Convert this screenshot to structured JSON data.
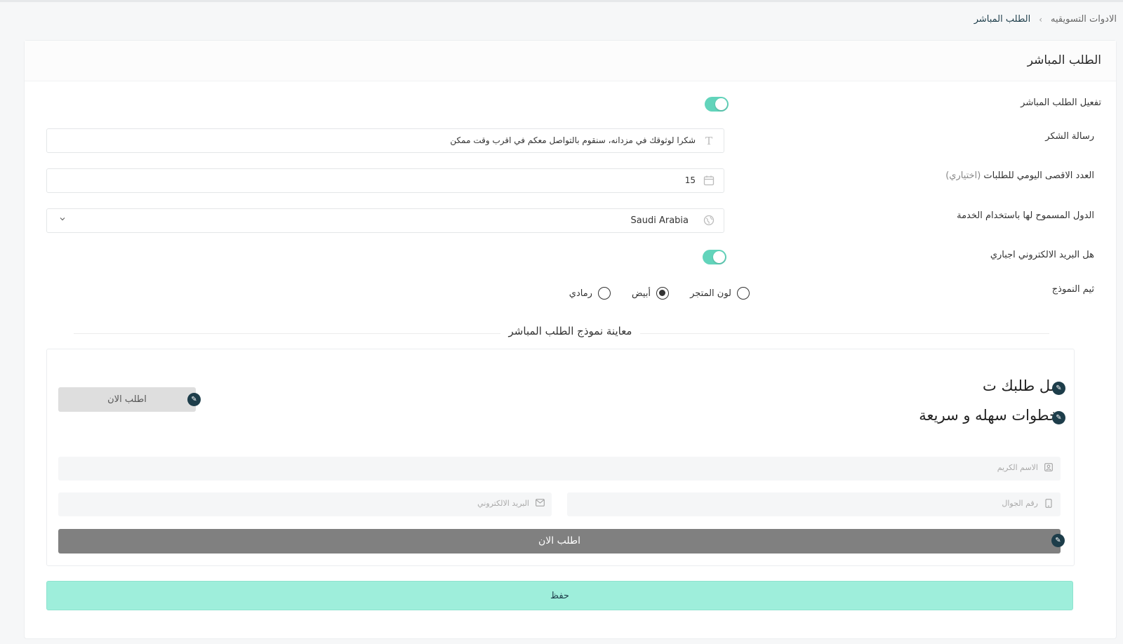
{
  "breadcrumb": {
    "parent": "الادوات التسويقيه",
    "separator": "›",
    "current": "الطلب المباشر"
  },
  "card": {
    "title": "الطلب المباشر"
  },
  "settings": {
    "enable_direct_order_label": "تفعيل الطلب المباشر",
    "enable_direct_order": true,
    "thank_message_label": "رسالة الشكر",
    "thank_message_value": "شكرا لوثوقك في مزدانه، سنقوم بالتواصل معكم في اقرب وقت ممكن",
    "max_daily_label": "العدد الاقصى اليومي للطلبات",
    "max_daily_optional": "(اختياري)",
    "max_daily_value": "15",
    "countries_label": "الدول المسموح لها باستخدام الخدمة",
    "countries_value": "Saudi Arabia",
    "email_required_label": "هل البريد الالكتروني اجباري",
    "email_required": true,
    "theme_label": "ثيم النموذج",
    "theme_options": [
      "لون المتجر",
      "أبيض",
      "رمادي"
    ],
    "theme_selected": "أبيض"
  },
  "preview": {
    "title": "معاينة نموذج الطلب المباشر",
    "headline_1": "مل طلبك ت",
    "headline_2": "خطوات سهله و سريعة",
    "order_now_gray": "اطلب الان",
    "name_placeholder": "الاسم الكريم",
    "phone_placeholder": "رقم الجوال",
    "email_placeholder": "البريد الالكتروني",
    "submit_label": "اطلب الان"
  },
  "actions": {
    "save_label": "حفظ"
  },
  "icons": {
    "text": "text-icon",
    "calendar": "calendar-icon",
    "globe": "globe-icon",
    "chevron": "chevron-down-icon",
    "edit": "pencil-icon",
    "user": "user-icon",
    "phone": "phone-icon",
    "mail": "mail-icon"
  },
  "colors": {
    "accent": "#62d4bb",
    "save_bg": "#9eeedb",
    "dark": "#1d3d4a"
  }
}
